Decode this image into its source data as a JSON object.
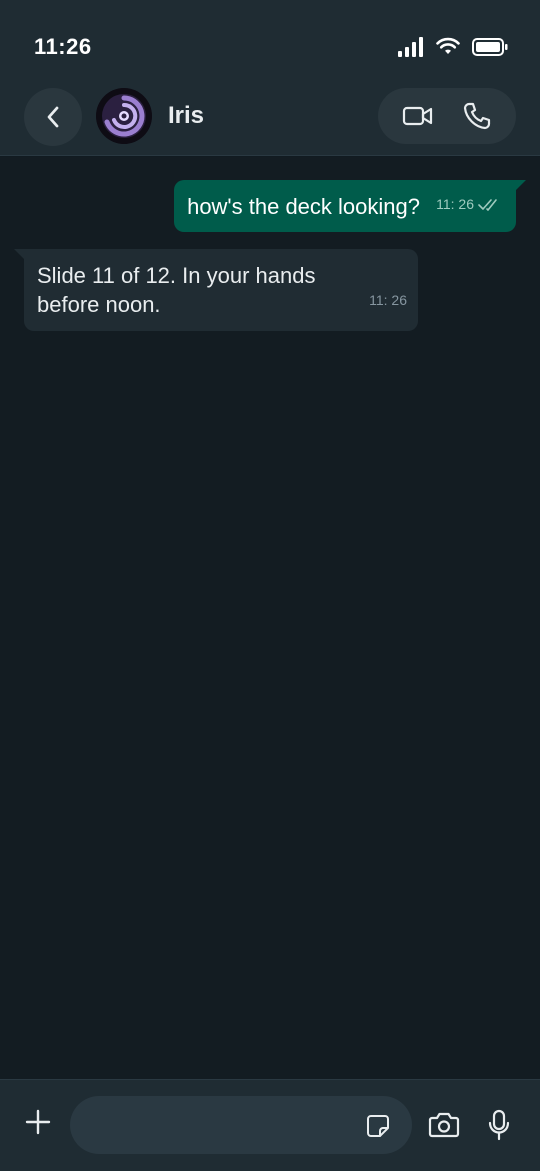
{
  "status_bar": {
    "time": "11:26",
    "icons": [
      "signal-icon",
      "wifi-icon",
      "battery-icon"
    ]
  },
  "header": {
    "back_icon": "chevron-left-icon",
    "contact_name": "Iris",
    "avatar_icon": "purple-swirl-avatar",
    "actions": [
      "video-call-icon",
      "phone-icon"
    ]
  },
  "messages": [
    {
      "direction": "outgoing",
      "text": "how's the deck looking?",
      "time": "11: 26",
      "status": "read"
    },
    {
      "direction": "incoming",
      "text_line1": "Slide 11 of 12. In your hands",
      "text_line2": "before noon.",
      "time": "11: 26"
    }
  ],
  "input_bar": {
    "placeholder": "",
    "icons": [
      "plus-icon",
      "sticker-icon",
      "camera-icon",
      "microphone-icon"
    ]
  },
  "colors": {
    "outgoing_bubble": "#005c4b",
    "incoming_bubble": "#202c33",
    "background": "#131c22",
    "header": "#1f2c33"
  }
}
